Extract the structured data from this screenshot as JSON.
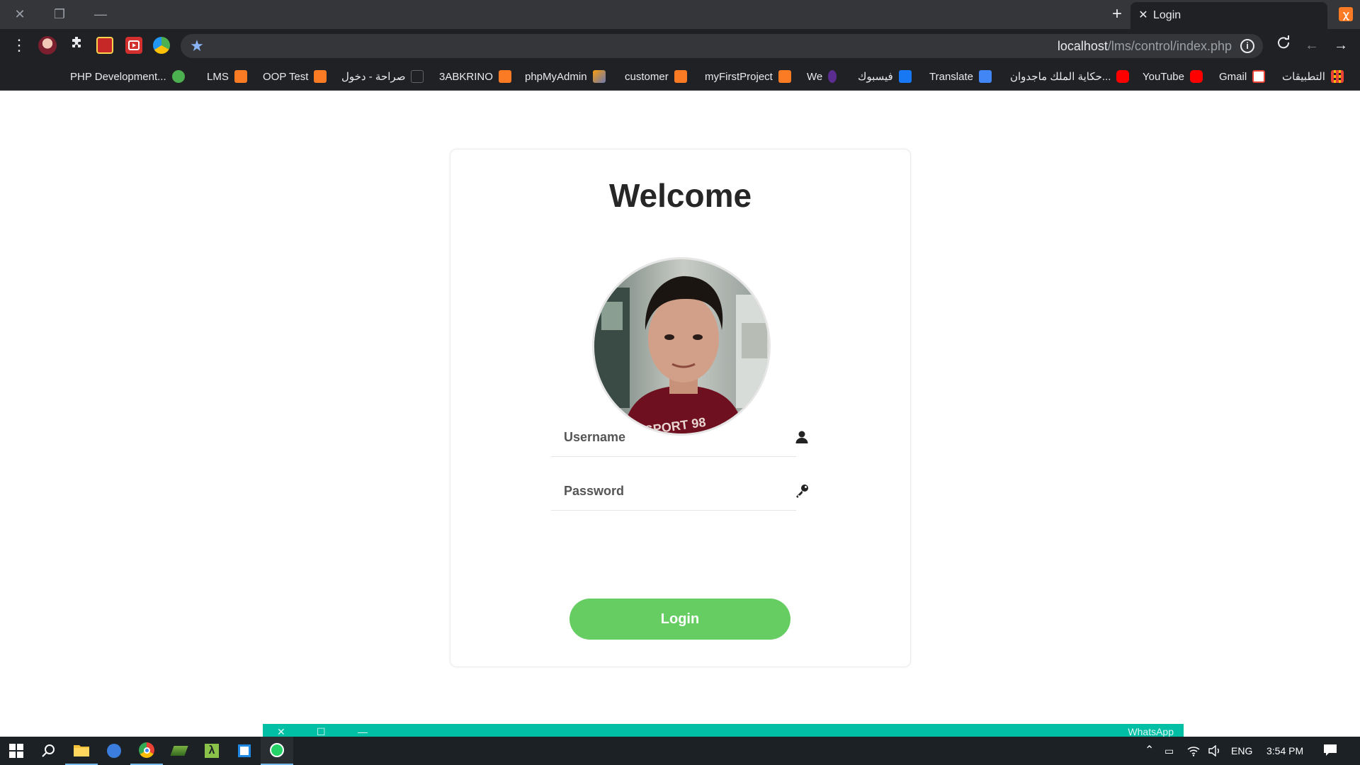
{
  "browser": {
    "tab": {
      "title": "Login"
    },
    "address_bar": {
      "host": "localhost",
      "path": "/lms/control/index.php"
    },
    "bookmarks": [
      {
        "label": "التطبيقات",
        "icon": "apps-grid-icon",
        "color": "#f4b400"
      },
      {
        "label": "Gmail",
        "icon": "gmail-icon",
        "color": "#ea4335"
      },
      {
        "label": "YouTube",
        "icon": "youtube-icon",
        "color": "#ff0000"
      },
      {
        "label": "حكاية الملك ماجدوان...",
        "icon": "youtube-icon",
        "color": "#ff0000"
      },
      {
        "label": "Translate",
        "icon": "translate-icon",
        "color": "#4285f4"
      },
      {
        "label": "فيسبوك",
        "icon": "facebook-icon",
        "color": "#1877f2"
      },
      {
        "label": "We",
        "icon": "we-icon",
        "color": "#5c2d91"
      },
      {
        "label": "myFirstProject",
        "icon": "xampp-icon",
        "color": "#fb7a24"
      },
      {
        "label": "customer",
        "icon": "xampp-icon",
        "color": "#fb7a24"
      },
      {
        "label": "phpMyAdmin",
        "icon": "phpmyadmin-icon",
        "color": "#f89c0e"
      },
      {
        "label": "3ABKRINO",
        "icon": "xampp-icon",
        "color": "#fb7a24"
      },
      {
        "label": "صراحة - دخول",
        "icon": "mail-icon",
        "color": "#5f6368"
      },
      {
        "label": "OOP Test",
        "icon": "xampp-icon",
        "color": "#fb7a24"
      },
      {
        "label": "LMS",
        "icon": "xampp-icon",
        "color": "#fb7a24"
      },
      {
        "label": "PHP Development...",
        "icon": "globe-icon",
        "color": "#4caf50"
      }
    ]
  },
  "page": {
    "heading": "Welcome",
    "username": {
      "placeholder": "Username",
      "value": ""
    },
    "password": {
      "placeholder": "Password",
      "value": ""
    },
    "login_label": "Login"
  },
  "popup": {
    "title": "WhatsApp"
  },
  "taskbar": {
    "language": "ENG",
    "time": "3:54 PM"
  },
  "colors": {
    "login_button": "#66cd63",
    "chrome_dark": "#202124",
    "taskbar": "#1c2126",
    "whatsapp": "#00bfa5"
  }
}
